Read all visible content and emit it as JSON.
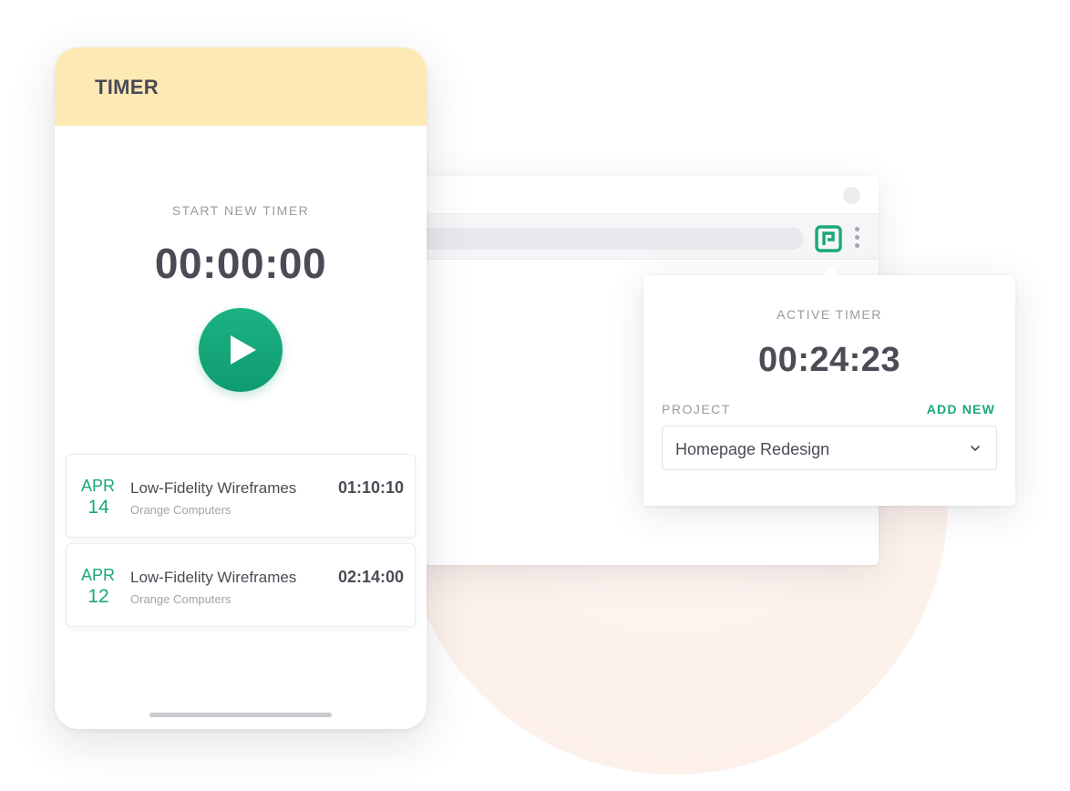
{
  "phone": {
    "title": "TIMER",
    "start_label": "START NEW TIMER",
    "time": "00:00:00",
    "play_icon": "play-icon",
    "entries": [
      {
        "month": "APR",
        "day": "14",
        "title": "Low-Fidelity Wireframes",
        "client": "Orange Computers",
        "duration": "01:10:10"
      },
      {
        "month": "APR",
        "day": "12",
        "title": "Low-Fidelity Wireframes",
        "client": "Orange Computers",
        "duration": "02:14:00"
      }
    ]
  },
  "popup": {
    "label": "ACTIVE TIMER",
    "time": "00:24:23",
    "project_label": "PROJECT",
    "add_new": "ADD NEW",
    "project_value": "Homepage Redesign"
  },
  "colors": {
    "accent_green": "#1aa87b",
    "header_yellow": "#fde9b4",
    "text_dark": "#4b4b55",
    "text_muted": "#9a9aa3"
  }
}
